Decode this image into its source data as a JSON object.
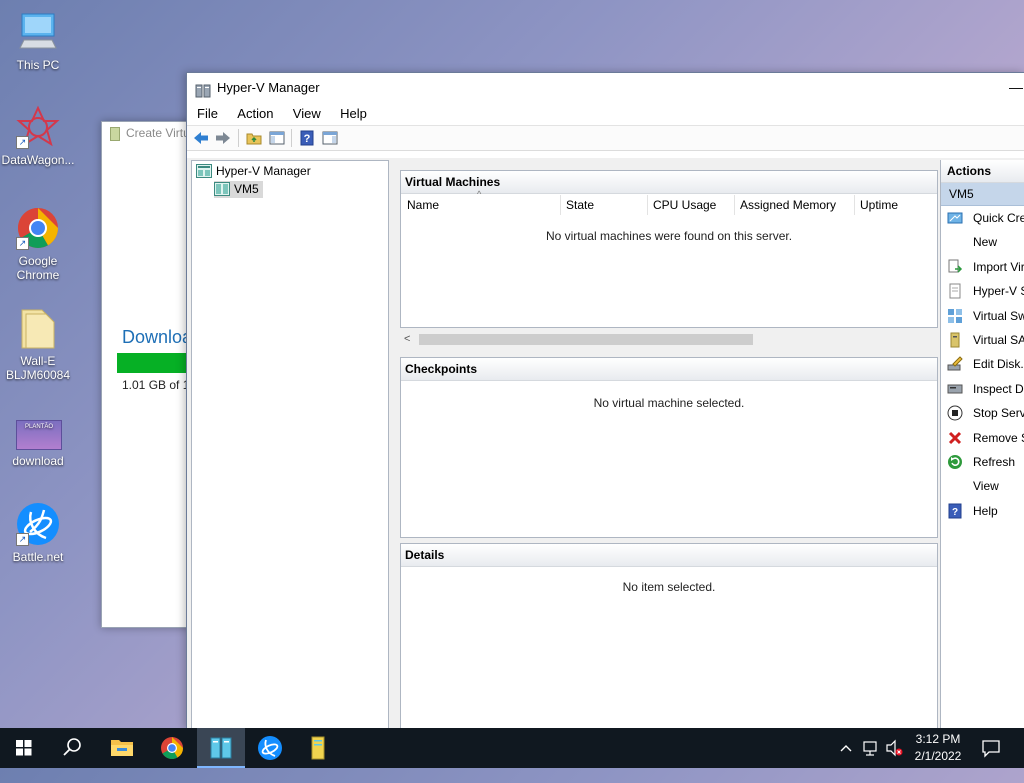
{
  "desktop": {
    "icons": [
      {
        "label": "This PC"
      },
      {
        "label": "DataWagon..."
      },
      {
        "label": "Google Chrome"
      },
      {
        "label": "Wall-E BLJM60084"
      },
      {
        "label": "download"
      },
      {
        "label": "Battle.net"
      }
    ],
    "download_thumb_text": "PLANTÃO"
  },
  "background_window": {
    "title": "Create Virtu",
    "heading": "Downloa",
    "progress": 1.0,
    "size_text": "1.01 GB of 1"
  },
  "window": {
    "title": "Hyper-V Manager",
    "minimize": "—",
    "menu": [
      "File",
      "Action",
      "View",
      "Help"
    ],
    "tree": {
      "root": "Hyper-V Manager",
      "child": "VM5"
    },
    "virtual_machines": {
      "title": "Virtual Machines",
      "columns": [
        "Name",
        "State",
        "CPU Usage",
        "Assigned Memory",
        "Uptime"
      ],
      "empty_message": "No virtual machines were found on this server."
    },
    "checkpoints": {
      "title": "Checkpoints",
      "empty_message": "No virtual machine selected."
    },
    "details": {
      "title": "Details",
      "empty_message": "No item selected."
    },
    "actions": {
      "title": "Actions",
      "section": "VM5",
      "items": [
        {
          "label": "Quick Cre",
          "icon": "quick-create-icon"
        },
        {
          "label": "New",
          "icon": ""
        },
        {
          "label": "Import Vir",
          "icon": "import-icon"
        },
        {
          "label": "Hyper-V S",
          "icon": "settings-doc-icon"
        },
        {
          "label": "Virtual Sw",
          "icon": "virtual-switch-icon"
        },
        {
          "label": "Virtual SA",
          "icon": "virtual-san-icon"
        },
        {
          "label": "Edit Disk...",
          "icon": "edit-disk-icon"
        },
        {
          "label": "Inspect Di",
          "icon": "inspect-disk-icon"
        },
        {
          "label": "Stop Servi",
          "icon": "stop-icon"
        },
        {
          "label": "Remove S",
          "icon": "remove-icon"
        },
        {
          "label": "Refresh",
          "icon": "refresh-icon"
        },
        {
          "label": "View",
          "icon": ""
        },
        {
          "label": "Help",
          "icon": "help-icon"
        }
      ]
    }
  },
  "taskbar": {
    "time": "3:12 PM",
    "date": "2/1/2022"
  },
  "colors": {
    "accent": "#1e6fb6",
    "progress": "#06b025",
    "taskbar": "#101820",
    "selection": "#c5d6ea"
  }
}
